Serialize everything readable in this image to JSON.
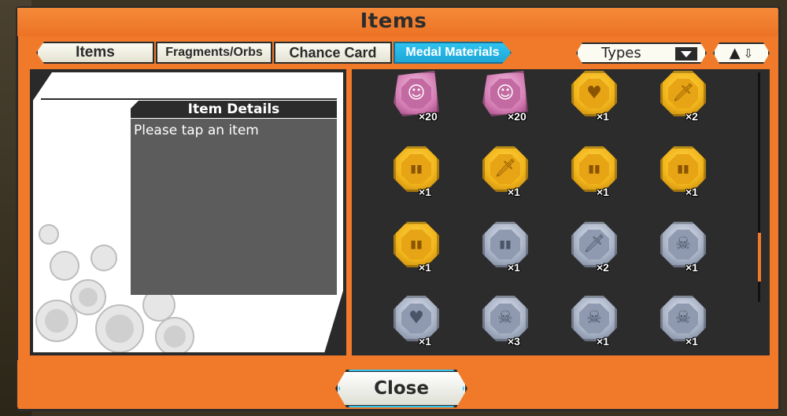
{
  "title": "Items",
  "tabs": [
    "Items",
    "Fragments/Orbs",
    "Chance Card",
    "Medal Materials"
  ],
  "active_tab": "Medal Materials",
  "filter": {
    "label": "Types"
  },
  "details": {
    "header": "Item Details",
    "placeholder": "Please tap an item"
  },
  "items": [
    {
      "type": "pink",
      "icon": "character-medal-icon",
      "qty": "×20"
    },
    {
      "type": "pink",
      "icon": "character-medal-icon",
      "qty": "×20"
    },
    {
      "type": "gold",
      "icon": "heart-medal-icon",
      "qty": "×1"
    },
    {
      "type": "gold",
      "icon": "sword-medal-icon",
      "qty": "×2"
    },
    {
      "type": "gold",
      "icon": "armor-medal-icon",
      "qty": "×1"
    },
    {
      "type": "gold",
      "icon": "sword-medal-icon",
      "qty": "×1"
    },
    {
      "type": "gold",
      "icon": "armor-medal-icon",
      "qty": "×1"
    },
    {
      "type": "gold",
      "icon": "armor-medal-icon",
      "qty": "×1"
    },
    {
      "type": "gold",
      "icon": "armor-medal-icon",
      "qty": "×1"
    },
    {
      "type": "silver",
      "icon": "armor-medal-icon",
      "qty": "×1"
    },
    {
      "type": "silver",
      "icon": "sword-medal-icon",
      "qty": "×2"
    },
    {
      "type": "silver",
      "icon": "skull-medal-icon",
      "qty": "×1"
    },
    {
      "type": "silver",
      "icon": "heart-medal-icon",
      "qty": "×1"
    },
    {
      "type": "silver",
      "icon": "skull-medal-icon",
      "qty": "×3"
    },
    {
      "type": "silver",
      "icon": "skull-medal-icon",
      "qty": "×1"
    },
    {
      "type": "silver",
      "icon": "skull-medal-icon",
      "qty": "×1"
    }
  ],
  "close_label": "Close",
  "colors": {
    "frame": "#f07a2a",
    "accent": "#2fc3ef",
    "panel": "#2b2b2b"
  }
}
